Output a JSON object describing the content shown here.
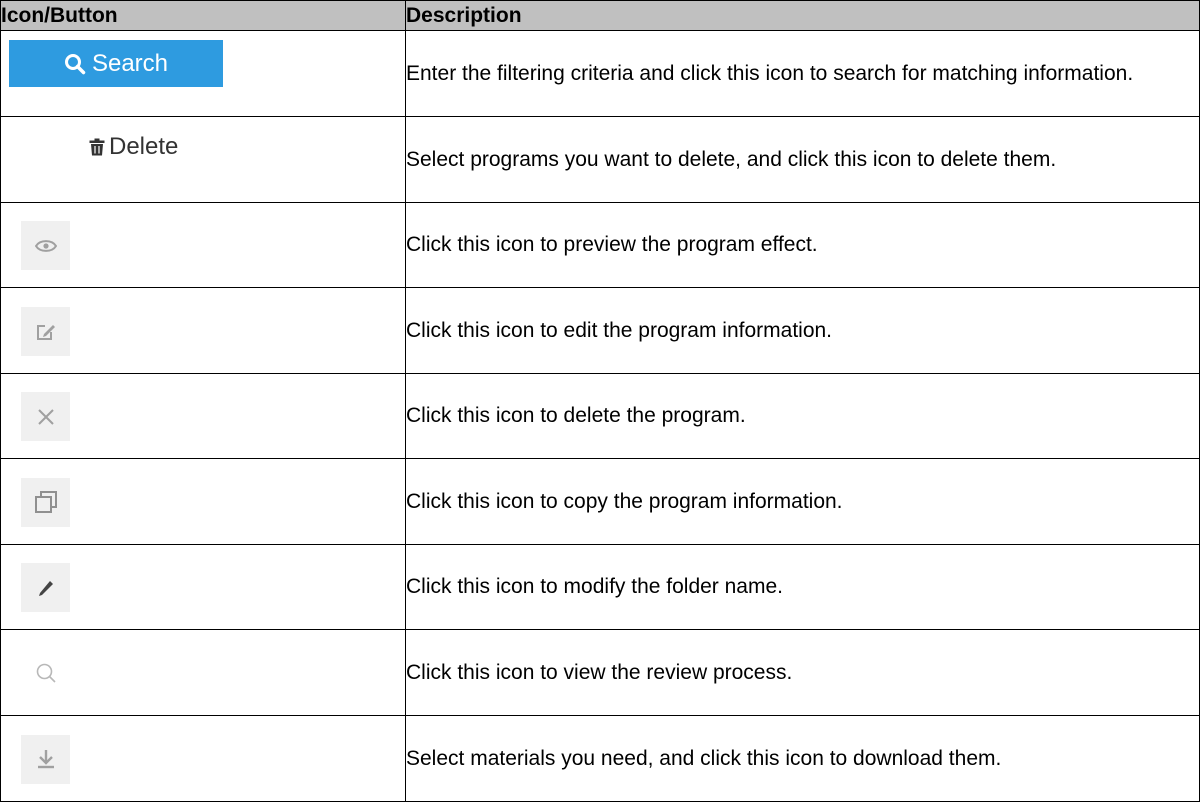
{
  "header": {
    "col_icon": "Icon/Button",
    "col_desc": "Description"
  },
  "rows": [
    {
      "icon": "search-icon",
      "label": "Search",
      "description": "Enter the filtering criteria and click this icon to search for matching information."
    },
    {
      "icon": "trash-icon",
      "label": "Delete",
      "description": "Select programs you want to delete, and click this icon to delete them."
    },
    {
      "icon": "eye-icon",
      "description": "Click this icon to preview the program effect."
    },
    {
      "icon": "edit-icon",
      "description": "Click this icon to edit the program information."
    },
    {
      "icon": "close-icon",
      "description": "Click this icon to delete the program."
    },
    {
      "icon": "copy-icon",
      "description": "Click this icon to copy the program information."
    },
    {
      "icon": "pencil-icon",
      "description": "Click this icon to modify the folder name."
    },
    {
      "icon": "magnifier-icon",
      "description": "Click this icon to view the review process."
    },
    {
      "icon": "download-icon",
      "description": "Select materials you need, and click this icon to download them."
    }
  ],
  "colors": {
    "header_bg": "#c0c0c0",
    "search_button_bg": "#2e9be0",
    "icon_tile_bg": "#f0f0f0",
    "icon_gray": "#a0a0a0"
  }
}
